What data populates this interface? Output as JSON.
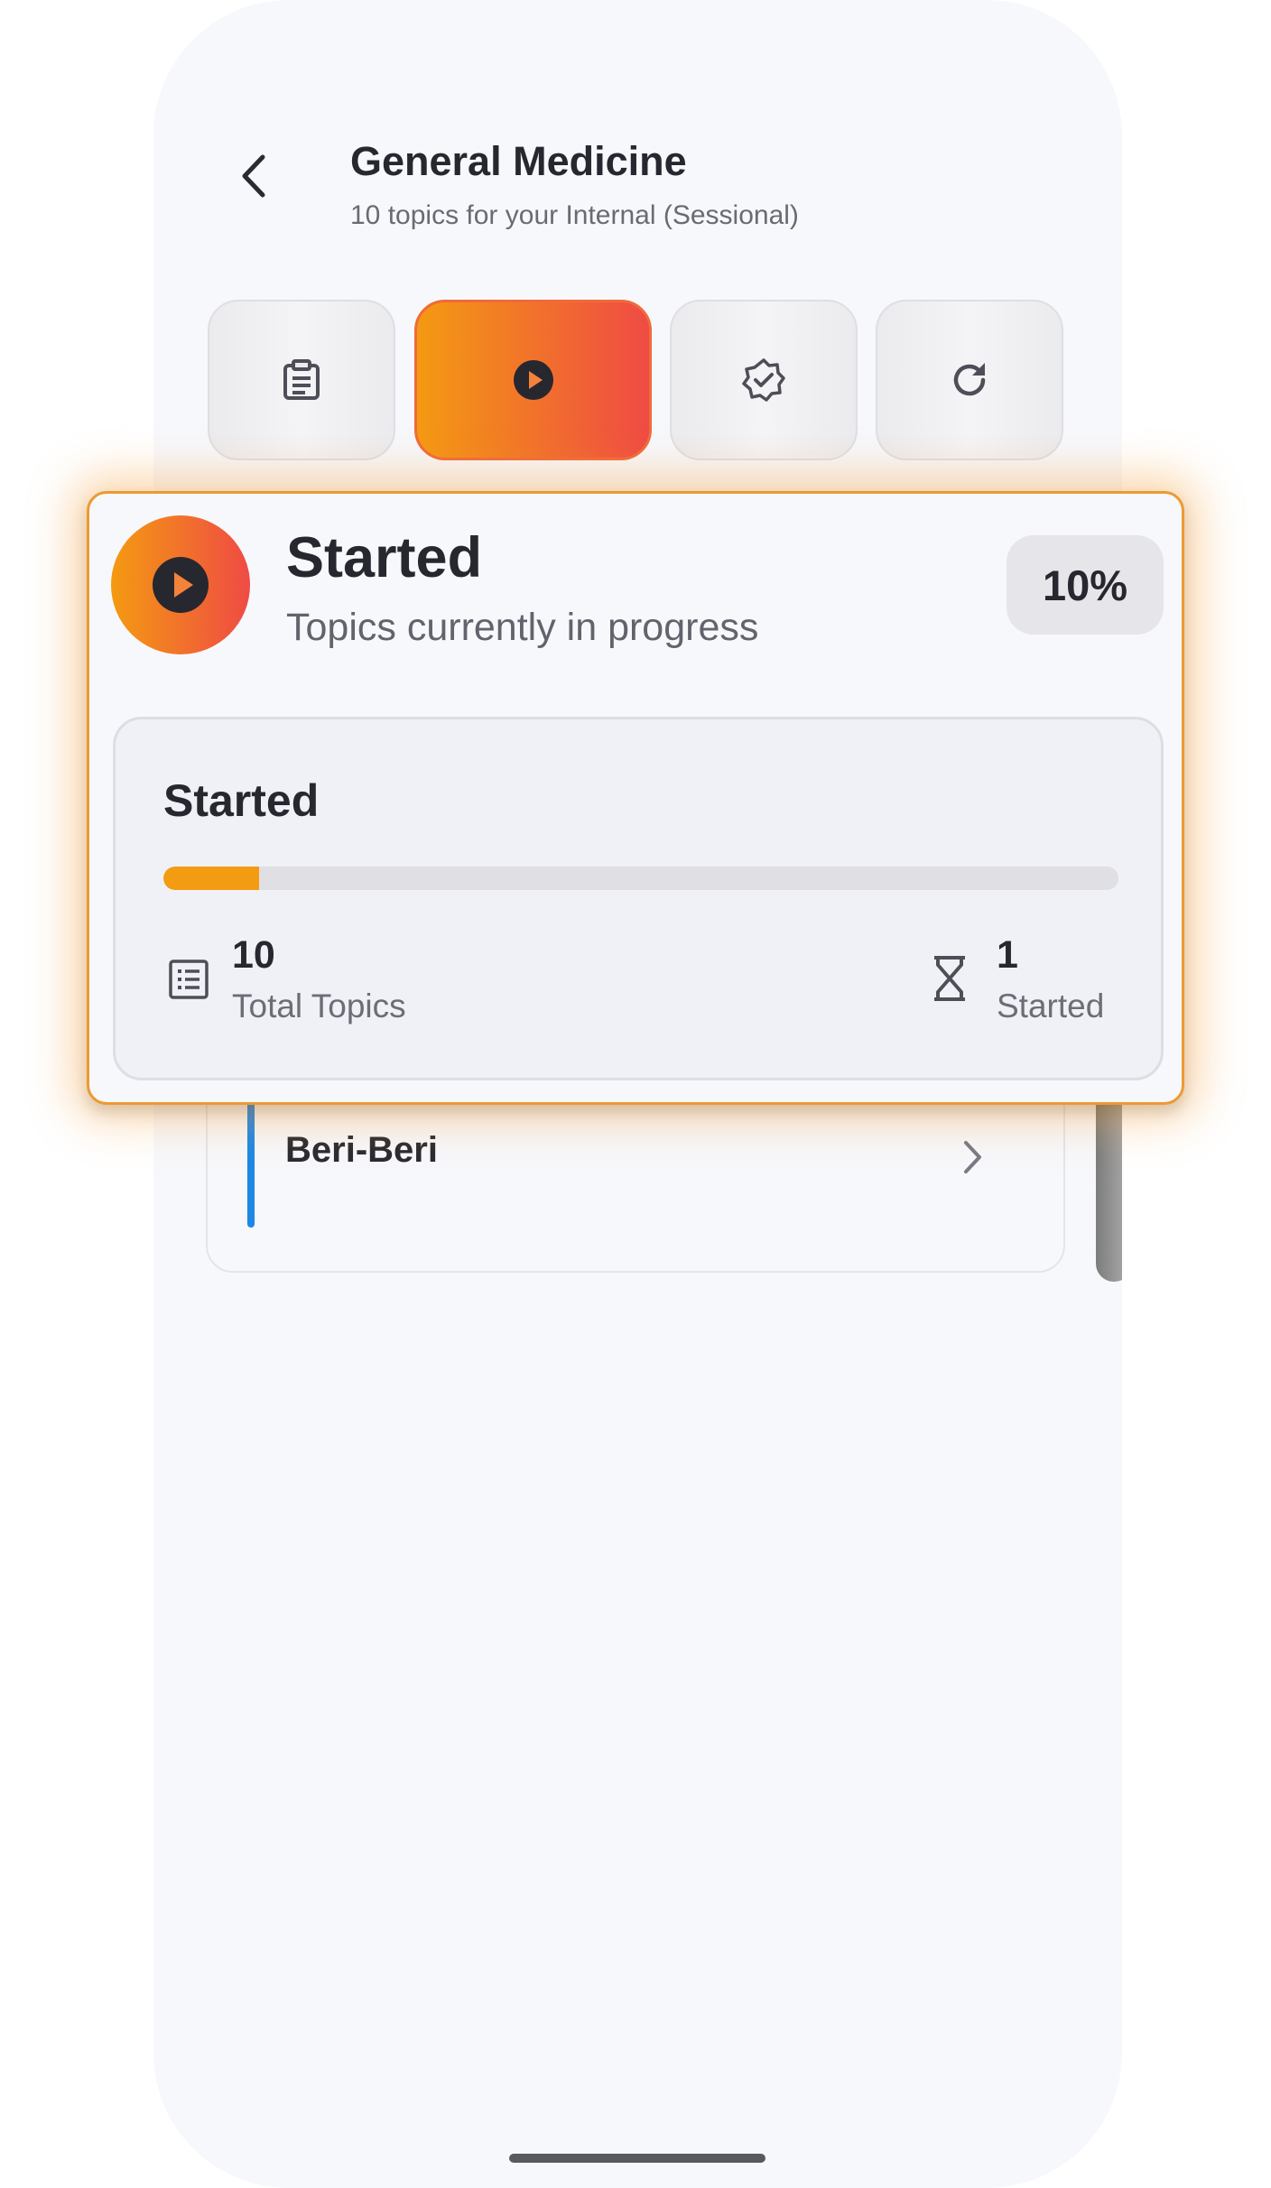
{
  "header": {
    "title": "General Medicine",
    "subtitle": "10 topics for your Internal (Sessional)"
  },
  "filters": [
    {
      "icon": "clipboard-icon",
      "active": false
    },
    {
      "icon": "play-circle-icon",
      "active": true
    },
    {
      "icon": "verified-badge-icon",
      "active": false
    },
    {
      "icon": "refresh-icon",
      "active": false
    }
  ],
  "popup": {
    "title": "Started",
    "description": "Topics currently in progress",
    "percent_label": "10%",
    "stats": {
      "heading": "Started",
      "progress": 0.1,
      "total_value": "10",
      "total_label": "Total Topics",
      "started_value": "1",
      "started_label": "Started"
    }
  },
  "topics": [
    {
      "name": "Beri-Beri"
    }
  ],
  "colors": {
    "accent_start": "#f49a12",
    "accent_end": "#ef4b44",
    "progress": "#f39c12",
    "topic_accent": "#1e88e5",
    "text_dark": "#27272f"
  }
}
